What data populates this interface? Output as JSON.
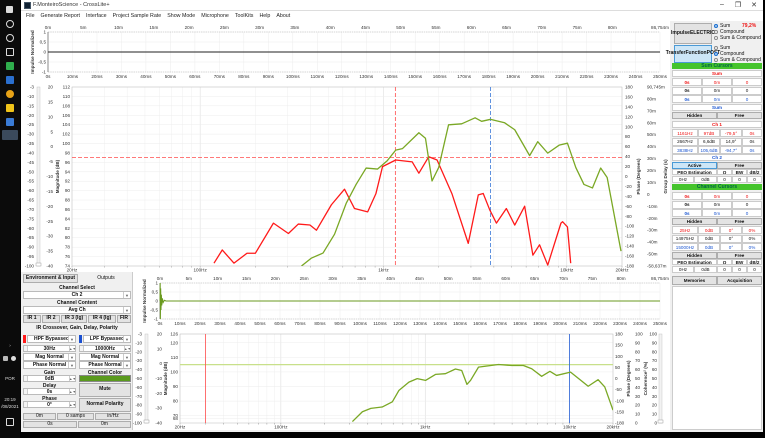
{
  "window": {
    "title": "F.MonteiroScience - CrossLite+",
    "minimize": "–",
    "maximize": "❐",
    "close": "✕"
  },
  "menu": [
    "File",
    "Generate Report",
    "Interface",
    "Project Sample Rate",
    "Show Mode",
    "Microphone",
    "ToolKits",
    "Help",
    "About"
  ],
  "taskbar": {
    "lang": "POR",
    "time": "20:19",
    "date": "/08/2021",
    "chevron": "›"
  },
  "left_panel": {
    "tabs": [
      "Environment & Input",
      "Outputs"
    ],
    "channel_select_label": "Channel Select",
    "channel_select": "Ch 2",
    "channel_content_label": "Channel Content",
    "channel_content": "Avg Ch",
    "ir_buttons": [
      "IR 1",
      "IR 2",
      "IR 3 (lg)",
      "IR 4 (lg)",
      "FIR"
    ],
    "section_title": "IR Crossover, Gain, Delay, Polarity",
    "hpf": {
      "type": "HPF Bypassed",
      "freq": "30Hz",
      "mag": "Mag Normal",
      "phase": "Phase Normal",
      "color": "#ff1a1a"
    },
    "lpf": {
      "type": "LPF Bypassed",
      "freq": "10000Hz",
      "mag": "Mag Normal",
      "phase": "Phase Normal",
      "color": "#1a4fd0"
    },
    "gain_label": "Gain",
    "gain": "0dB",
    "delay_label": "Delay",
    "delay": "0s",
    "phase_label": "Phase",
    "phase": "0°",
    "channel_color_label": "Channel Color",
    "channel_color": "#5a9a1e",
    "mute": "Mute",
    "polarity": "Normal Polarity",
    "bottom_row": [
      "0m",
      "0 samps",
      "in/Hz"
    ],
    "bottom_row2": [
      "0s",
      "0m"
    ]
  },
  "right_panel": {
    "impulse_button": [
      "Impulse",
      "ELECTRIC"
    ],
    "impulse_options": [
      "Sum",
      "Compound",
      "Sum & Compound"
    ],
    "impulse_selected": 0,
    "percent": "79,2%",
    "tf_button": [
      "Transfer",
      "Function",
      "POST"
    ],
    "tf_options": [
      "Sum",
      "Compound",
      "Sum & Compound"
    ],
    "tf_selected": 1,
    "sum_cursors_title": "Sum Cursors",
    "sum_select": "Sum",
    "sum_cursor_rows": [
      [
        "0s",
        "0m",
        "0"
      ],
      [
        "0s",
        "0m",
        "0"
      ],
      [
        "0s",
        "0m",
        "0"
      ]
    ],
    "sum_select2": "Sum",
    "sum_modes": [
      "Hidden",
      "Free"
    ],
    "ch1_select": "Ch 1",
    "ch1_rows": [
      [
        "1161Hz",
        "97dB",
        "-79,5°",
        "0s"
      ],
      [
        "2667Hz",
        "6,6dB",
        "14,9°",
        "0s"
      ],
      [
        "3838Hz",
        "105,6dB",
        "-94,7°",
        "0s"
      ]
    ],
    "ch2_select": "Ch 2",
    "ch_modes": [
      "Active",
      "Free"
    ],
    "peq_headers": [
      "PEQ Estimation",
      "Q",
      "BW",
      "dB/2"
    ],
    "peq_values": [
      "0Hz",
      "0dB",
      "0",
      "0",
      "0"
    ],
    "channel_cursors_title": "Channel Cursors",
    "channel_cursor_rows": [
      [
        "0s",
        "0m",
        "0"
      ],
      [
        "0s",
        "0m",
        "0"
      ],
      [
        "0s",
        "0m",
        "0"
      ]
    ],
    "channel_modes": [
      "Hidden",
      "Free"
    ],
    "channel_rows": [
      [
        "25Hz",
        "0dB",
        "0°",
        "0%"
      ],
      [
        "14975Hz",
        "0dB",
        "0°",
        "0%"
      ],
      [
        "15000Hz",
        "0dB",
        "0°",
        "0%"
      ]
    ],
    "channel_modes2": [
      "Hidden",
      "Free"
    ],
    "peq2_headers": [
      "PEQ Estimation",
      "Q",
      "BW",
      "dB/2"
    ],
    "peq2_values": [
      "0Hz",
      "0dB",
      "0",
      "0",
      "0"
    ],
    "tabs": [
      "Memories",
      "Acquisition"
    ],
    "accent_green": "#45c42c"
  },
  "chart_data": [
    {
      "type": "line",
      "title": "",
      "ylabel": "Impulse Normalized",
      "ylim": [
        -1,
        1
      ],
      "yticks": [
        "1",
        "0,5",
        "0",
        "-0,5",
        "-1"
      ],
      "x_top_ticks": [
        "0m",
        "5m",
        "10m",
        "15m",
        "20m",
        "25m",
        "30m",
        "35m",
        "40m",
        "45m",
        "50m",
        "55m",
        "60m",
        "65m",
        "70m",
        "75m",
        "80m"
      ],
      "x_top_end": "86,754m",
      "x_top_max": 86.754,
      "x_bottom_ticks": [
        "0s",
        "10ms",
        "20ms",
        "30ms",
        "40ms",
        "50ms",
        "60ms",
        "70ms",
        "80ms",
        "90ms",
        "100ms",
        "110ms",
        "120ms",
        "130ms",
        "140ms",
        "150ms",
        "160ms",
        "170ms",
        "180ms",
        "190ms",
        "200ms",
        "210ms",
        "220ms",
        "230ms",
        "240ms",
        "250ms"
      ],
      "xlim_ms": [
        0,
        250
      ],
      "series": [
        {
          "name": "impulse",
          "color": "#222222",
          "x": [
            0,
            250
          ],
          "y": [
            0,
            0
          ]
        }
      ]
    },
    {
      "type": "line",
      "title": "",
      "xlabel": "Frequency",
      "xlim": [
        20,
        20000
      ],
      "xscale": "log",
      "xtick_values": [
        20,
        100,
        1000,
        10000,
        20000
      ],
      "xtick_labels": [
        "20Hz",
        "100Hz",
        "1kHz",
        "10kHz",
        "20kHz"
      ],
      "ylabel": "Magnitude (dB)",
      "ylim": [
        74,
        112
      ],
      "yticks": [
        112,
        110,
        108,
        106,
        104,
        102,
        100,
        98,
        96,
        94,
        92,
        90,
        88,
        86,
        84,
        82,
        80,
        78,
        76,
        74
      ],
      "y2label": "Phase (Degrees)",
      "y2lim": [
        -180,
        180
      ],
      "y2ticks": [
        180,
        160,
        140,
        120,
        100,
        80,
        60,
        40,
        20,
        0,
        -20,
        -40,
        -60,
        -80,
        -100,
        -120,
        -140,
        -160,
        -180
      ],
      "y3label": "Group Delay (s)",
      "y3ticks": [
        "90,745m",
        "80m",
        "70m",
        "60m",
        "50m",
        "40m",
        "30m",
        "20m",
        "10m",
        "0",
        "-10m",
        "-20m",
        "-30m",
        "-40m",
        "-50m",
        "-58,637m"
      ],
      "extra_left_a": [
        "-3",
        "-10",
        "-15",
        "-20",
        "-25",
        "-30",
        "-35",
        "-40",
        "-45",
        "-50",
        "-55",
        "-60",
        "-65",
        "-70",
        "-75",
        "-80",
        "-85",
        "-90",
        "-95",
        "-100"
      ],
      "extra_left_b": [
        "20",
        "15",
        "10",
        "5",
        "0",
        "-5",
        "-10",
        "-15",
        "-20",
        "-25",
        "-30",
        "-35",
        "-40"
      ],
      "series": [
        {
          "name": "Magnitude",
          "axis": "mag",
          "color": "#ff1a1a",
          "x": [
            119,
            132,
            153,
            180,
            200,
            251,
            303,
            343,
            397,
            431,
            520,
            613,
            695,
            820,
            910,
            988,
            1166,
            1435,
            1560,
            1766,
            1960,
            2360,
            2900,
            3290,
            3500,
            3800,
            4130,
            4680,
            5200,
            5890,
            6530,
            7100,
            7870,
            9290,
            9480,
            10080,
            10500
          ],
          "y": [
            74.6,
            77.4,
            74.6,
            76.7,
            76.7,
            83.1,
            80.9,
            82.9,
            82.7,
            81.6,
            87.0,
            90.3,
            86.2,
            85.5,
            89.4,
            95.1,
            96.5,
            96.1,
            93.7,
            97.2,
            96.5,
            89.4,
            78.8,
            89.1,
            89.4,
            85.9,
            83.1,
            86.2,
            82.7,
            86.7,
            76.3,
            78.5,
            74.2,
            83.1,
            83.4,
            82.3,
            74.6
          ]
        },
        {
          "name": "Phase",
          "axis": "phase",
          "color": "#7aa825",
          "x": [
            357,
            405,
            468,
            541,
            626,
            709,
            804,
            929,
            1050,
            1166,
            1268,
            1560,
            1694,
            1840,
            2000,
            2265,
            2670,
            3160,
            3430,
            3840,
            4580,
            5200,
            6270,
            6940,
            7870,
            9080,
            10080,
            11200,
            12400,
            13800,
            15300,
            16600,
            19750
          ],
          "y": [
            -180,
            -164,
            -154,
            -116,
            -54,
            -16,
            17,
            15,
            32,
            53,
            56,
            88,
            77,
            -9,
            18,
            104,
            106,
            118,
            111,
            115,
            108,
            94,
            42,
            70,
            47,
            63,
            67,
            18,
            -16,
            -23,
            17,
            -2,
            -150
          ]
        }
      ],
      "cursors": [
        {
          "name": "ch1-cursor",
          "color": "#ff4d4d",
          "freq": 1161,
          "db": 97
        },
        {
          "name": "ch1-cursor-3",
          "color": "#3a78d8",
          "freq": 3838
        }
      ]
    },
    {
      "type": "line",
      "title": "",
      "ylabel": "Impulse Normalized",
      "ylim": [
        -1,
        1
      ],
      "yticks": [
        "1",
        "0,5",
        "0",
        "-0,5",
        "-1"
      ],
      "x_top_ticks": [
        "0m",
        "5m",
        "10m",
        "15m",
        "20m",
        "25m",
        "30m",
        "35m",
        "40m",
        "45m",
        "50m",
        "55m",
        "60m",
        "65m",
        "70m",
        "75m",
        "80m"
      ],
      "x_top_end": "86,754m",
      "x_top_max": 86.754,
      "x_bottom_ticks": [
        "0s",
        "10ms",
        "20ms",
        "30ms",
        "40ms",
        "50ms",
        "60ms",
        "70ms",
        "80ms",
        "90ms",
        "100ms",
        "110ms",
        "120ms",
        "130ms",
        "140ms",
        "150ms",
        "160ms",
        "170ms",
        "180ms",
        "190ms",
        "200ms",
        "210ms",
        "220ms",
        "230ms",
        "240ms",
        "250ms"
      ],
      "xlim_ms": [
        0,
        250
      ],
      "series": [
        {
          "name": "impulse",
          "color": "#6a9a1f",
          "x": [
            0,
            0.1,
            0.2,
            0.35,
            0.5,
            0.7,
            0.9,
            1.2,
            1.6,
            2.2,
            3,
            250
          ],
          "y": [
            0,
            1,
            -1,
            0.7,
            -0.5,
            0.35,
            -0.25,
            0.15,
            -0.08,
            0.04,
            0,
            0
          ]
        }
      ]
    },
    {
      "type": "line",
      "title": "",
      "xlabel": "Frequency",
      "xlim": [
        20,
        20000
      ],
      "xscale": "log",
      "xtick_values": [
        20,
        100,
        1000,
        10000,
        20000
      ],
      "xtick_labels": [
        "20Hz",
        "100Hz",
        "1kHz",
        "10kHz",
        "20kHz"
      ],
      "ylabel": "Magnitude (dB)",
      "ylim": [
        65,
        126
      ],
      "yticks": [
        126,
        120,
        110,
        100,
        90,
        80,
        70,
        68
      ],
      "y2label": "Phase (Degrees)",
      "y2ticks": [
        "180",
        "150",
        "100",
        "50",
        "0",
        "-50",
        "-100",
        "-150",
        "-180"
      ],
      "y3label": "Coherence² (%)",
      "y3ticks": [
        "100",
        "90",
        "80",
        "70",
        "60",
        "50",
        "40",
        "30",
        "20",
        "10",
        "0"
      ],
      "slider_ticks": [
        "100",
        "90",
        "80",
        "70",
        "60",
        "50",
        "40",
        "30",
        "20",
        "10",
        "0"
      ],
      "extra_left_a": [
        "-3",
        "-10",
        "-20",
        "-30",
        "-40",
        "-50",
        "-60",
        "-70",
        "-80",
        "-90",
        "-100"
      ],
      "extra_left_b": [
        "20",
        "10",
        "0",
        "-10",
        "-20",
        "-30",
        "-40"
      ],
      "hline": 105,
      "series": [
        {
          "name": "Magnitude",
          "axis": "mag",
          "color": "#7aa825",
          "x": [
            313,
            367,
            420,
            505,
            592,
            658,
            771,
            880,
            1005,
            1178,
            1380,
            1620,
            1790,
            1946,
            2060,
            2340,
            3220,
            3980,
            4790,
            5470,
            6410,
            7310,
            8130,
            10160,
            13460,
            15770,
            17540,
            20000
          ],
          "y": [
            66,
            72.7,
            75,
            76,
            79.5,
            87.4,
            93,
            95.4,
            94.2,
            98.3,
            98.8,
            102,
            101,
            91.5,
            94.2,
            103.3,
            105.1,
            104.4,
            104.4,
            102.2,
            97,
            100.4,
            97.6,
            99.9,
            90.2,
            94.7,
            89.7,
            73.8
          ]
        }
      ],
      "cursors": [
        {
          "name": "hpf-marker",
          "color": "#ff4d4d",
          "freq": 30
        },
        {
          "name": "lpf-marker",
          "color": "#2a62d8",
          "freq": 10000
        }
      ]
    }
  ]
}
